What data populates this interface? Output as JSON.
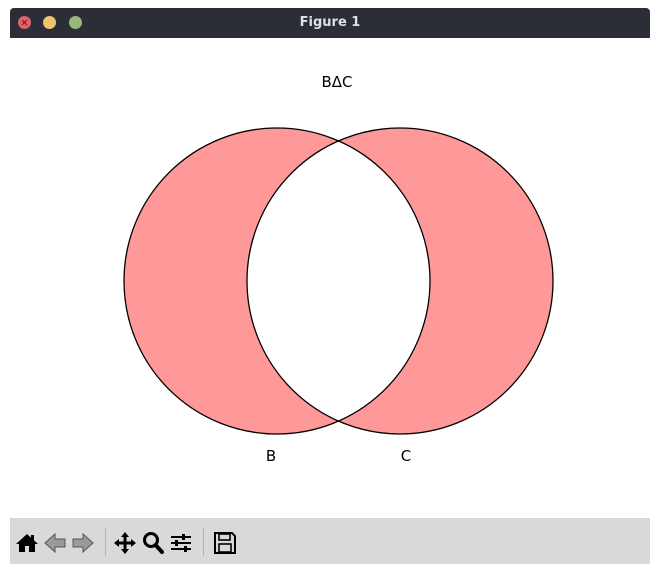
{
  "window": {
    "title": "Figure 1"
  },
  "chart_data": {
    "type": "venn",
    "title": "BΔC",
    "sets": [
      "B",
      "C"
    ],
    "highlighted_regions": [
      "B only",
      "C only"
    ],
    "fill_color": "#ff9999",
    "unhighlighted_color": "#ffffff",
    "outline_color": "#000000"
  },
  "toolbar": {
    "buttons": [
      {
        "name": "home-icon",
        "enabled": true
      },
      {
        "name": "back-icon",
        "enabled": false
      },
      {
        "name": "forward-icon",
        "enabled": false
      },
      {
        "name": "pan-icon",
        "enabled": true
      },
      {
        "name": "zoom-icon",
        "enabled": true
      },
      {
        "name": "subplots-icon",
        "enabled": true
      },
      {
        "name": "save-icon",
        "enabled": true
      }
    ]
  }
}
